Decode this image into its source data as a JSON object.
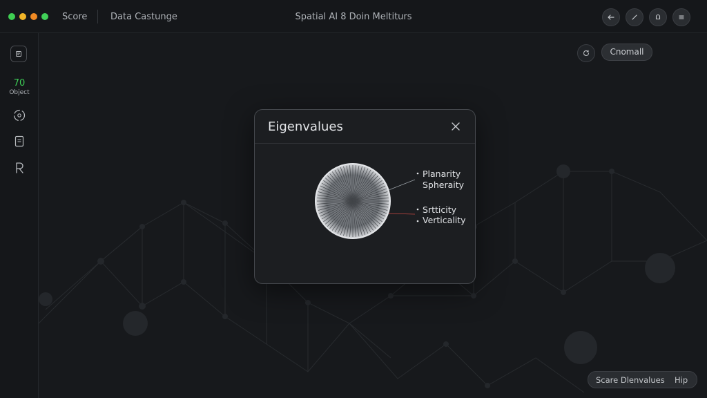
{
  "topbar": {
    "score_tab": "Score",
    "data_tab": "Data Castunge",
    "window_title": "Spatial AI 8 Doin Meltiturs",
    "buttons": [
      "back-arrow-icon",
      "pencil-icon",
      "bell-icon",
      "menu-icon"
    ]
  },
  "sidebar": {
    "object_count": "70",
    "object_label": "Object",
    "icons": [
      "box-icon",
      "target-icon",
      "clipboard-icon",
      "r-glyph-icon"
    ]
  },
  "canvas": {
    "refresh_icon": "refresh-icon",
    "mode_button": "Cnomall"
  },
  "dialog": {
    "title": "Eigenvalues",
    "close_icon": "close-icon",
    "labels": {
      "planarity": "Planarity",
      "sphericity": "Spheraity",
      "scatter": "Srtticity",
      "verticality": "Verticality"
    }
  },
  "bottom": {
    "score_label": "Scare Dlenvalues",
    "help_label": "Hip"
  },
  "colors": {
    "background": "#17191c",
    "accent_green": "#3ecf57",
    "dialog_bg": "#1c1e21"
  }
}
